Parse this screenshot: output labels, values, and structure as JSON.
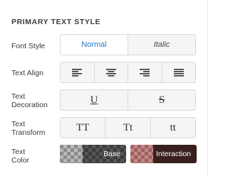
{
  "section": {
    "title": "PRIMARY TEXT STYLE"
  },
  "font_style": {
    "label": "Font Style",
    "options": [
      "Normal",
      "Italic"
    ],
    "selected": "Normal"
  },
  "text_align": {
    "label": "Text Align",
    "options": [
      "align-left-icon",
      "align-center-icon",
      "align-right-icon",
      "align-justify-icon"
    ]
  },
  "text_decoration": {
    "label_line1": "Text",
    "label_line2": "Decoration",
    "options": [
      "U",
      "S"
    ]
  },
  "text_transform": {
    "label_line1": "Text",
    "label_line2": "Transform",
    "options": [
      "TT",
      "Tt",
      "tt"
    ]
  },
  "text_color": {
    "label_line1": "Text",
    "label_line2": "Color",
    "base_label": "Base",
    "interaction_label": "Interaction",
    "active_color": "#1f78c8"
  }
}
